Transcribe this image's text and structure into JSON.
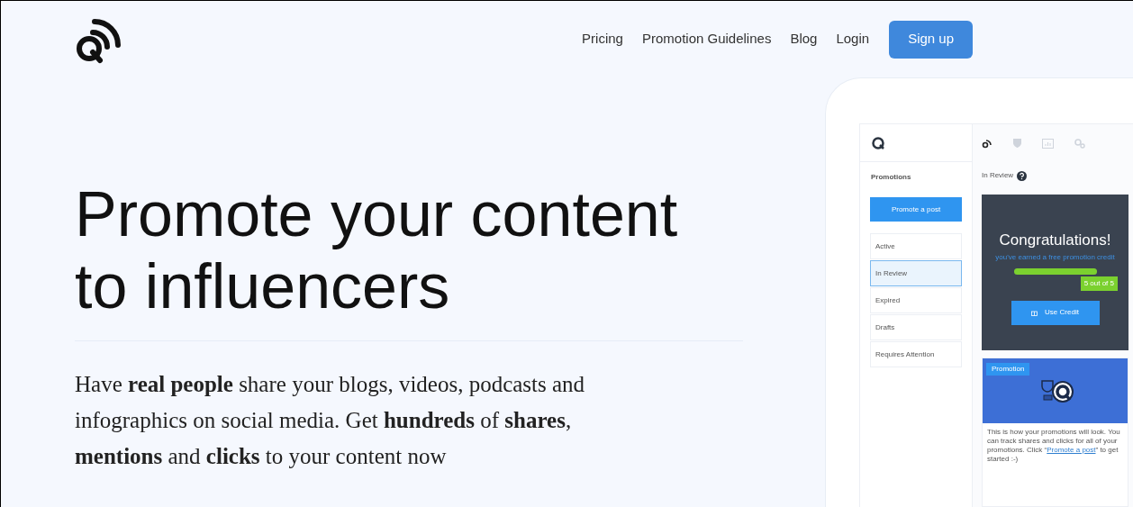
{
  "nav": {
    "links": [
      "Pricing",
      "Promotion Guidelines",
      "Blog",
      "Login"
    ],
    "signup": "Sign up"
  },
  "hero": {
    "title": "Promote your content to influencers",
    "body": "Have **real people** share your blogs, videos, podcasts and infographics on social media. Get **hundreds** of **shares**, **mentions** and **clicks** to your content now"
  },
  "app": {
    "sidebar_title": "Promotions",
    "promote_button": "Promote a post",
    "filters": [
      {
        "label": "Active",
        "selected": false
      },
      {
        "label": "In Review",
        "selected": true
      },
      {
        "label": "Expired",
        "selected": false
      },
      {
        "label": "Drafts",
        "selected": false
      },
      {
        "label": "Requires Attention",
        "selected": false
      }
    ],
    "section_title": "In Review",
    "congrats": {
      "title": "Congratulations!",
      "subtitle": "you've earned a free promotion credit",
      "progress": {
        "level": 1,
        "label": "5 out of 5"
      },
      "button": "Use Credit"
    },
    "promo": {
      "tag": "Promotion",
      "text_before": "This is how your promotions will look. You can track shares and clicks for all of your promotions. Click “",
      "link": "Promote a post",
      "text_after": "” to get started :-)"
    }
  }
}
